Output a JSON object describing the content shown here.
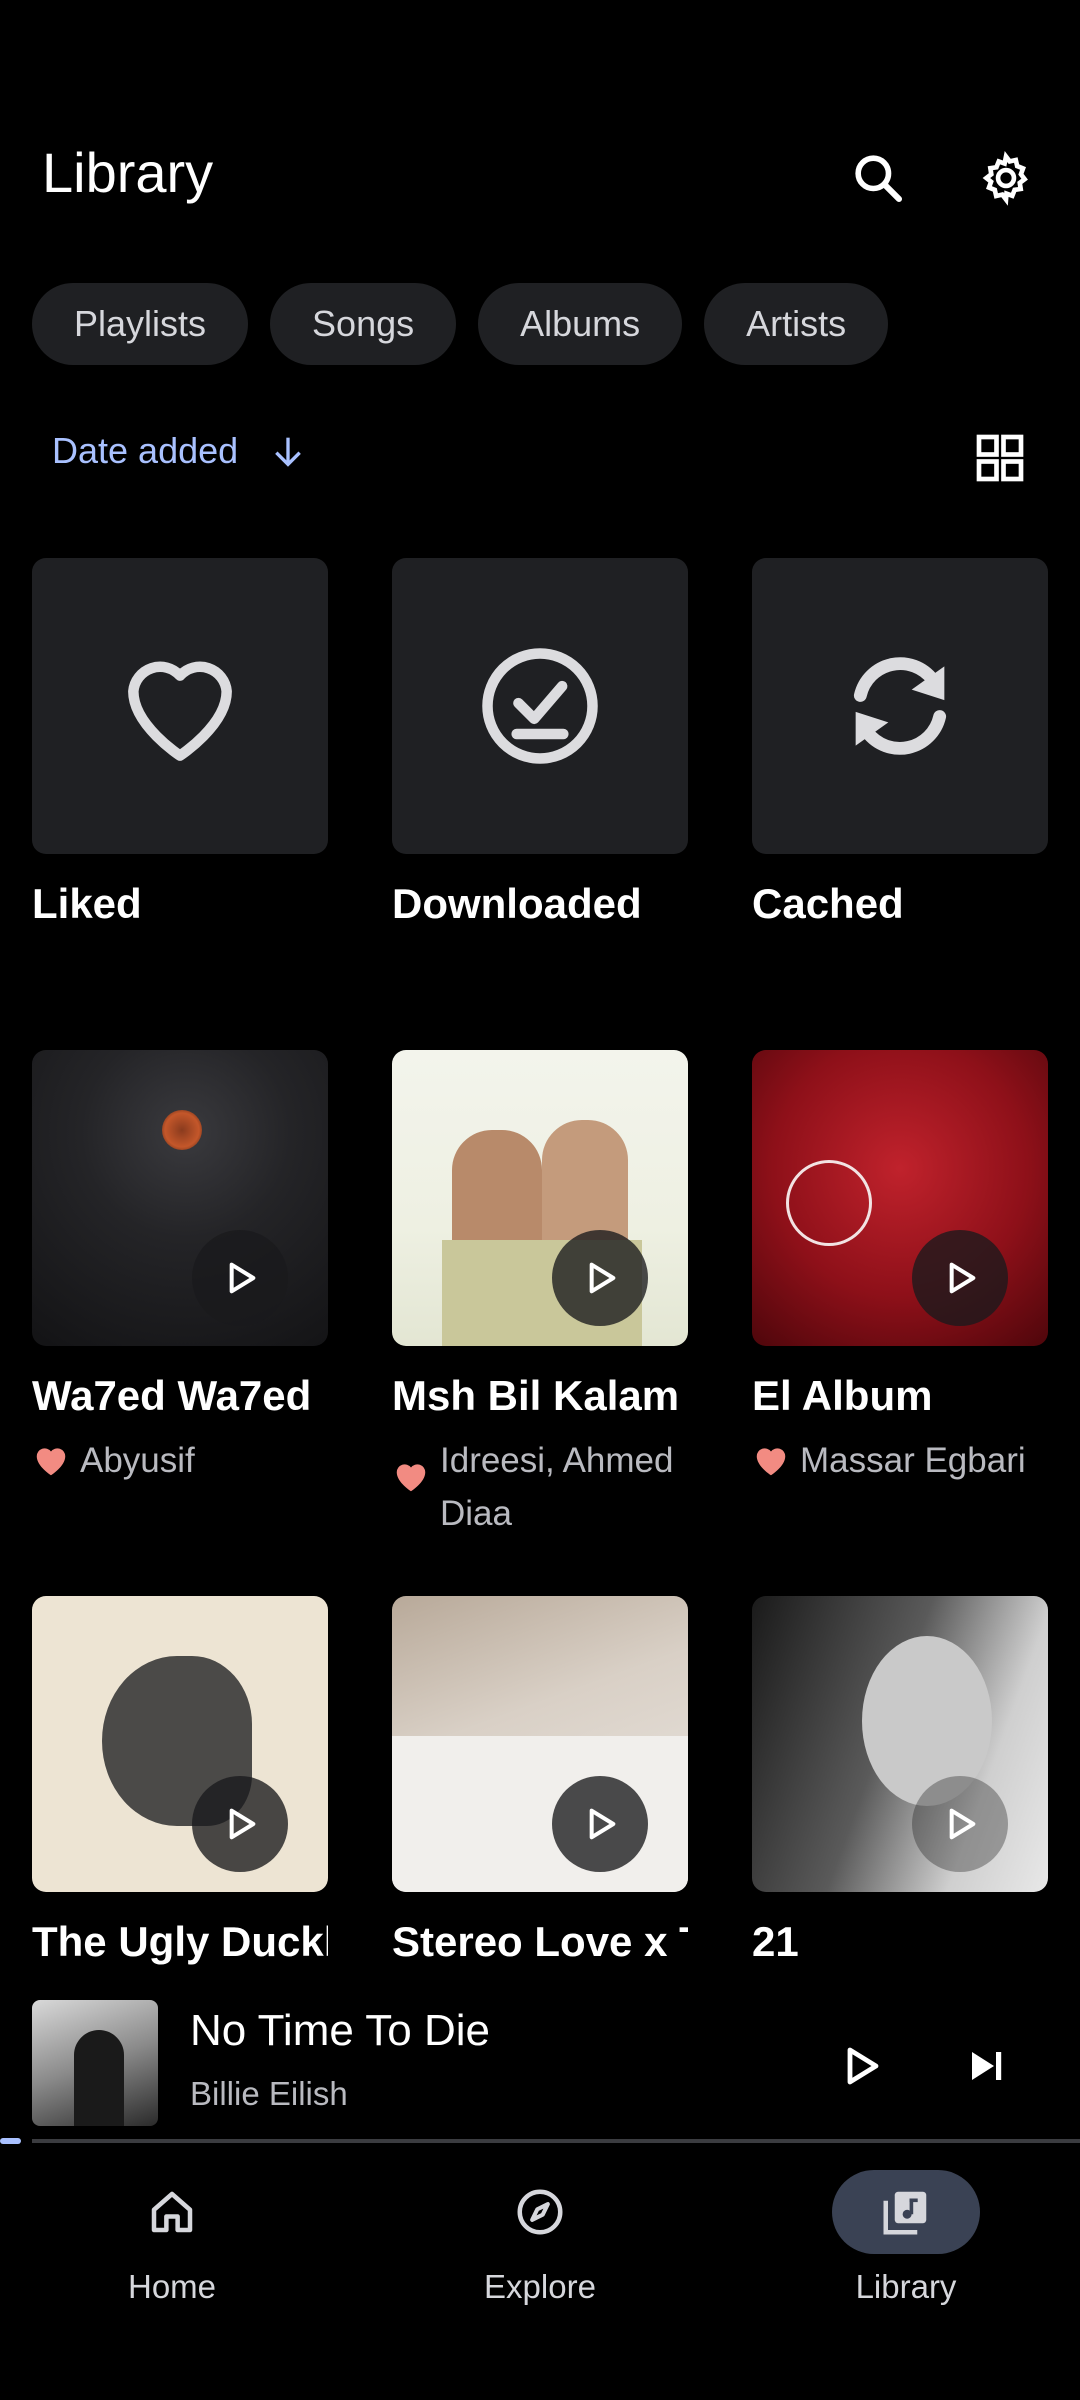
{
  "header": {
    "title": "Library"
  },
  "chips": [
    "Playlists",
    "Songs",
    "Albums",
    "Artists"
  ],
  "sort": {
    "label": "Date added"
  },
  "special": [
    {
      "label": "Liked",
      "icon": "heart-outline-icon"
    },
    {
      "label": "Downloaded",
      "icon": "download-check-icon"
    },
    {
      "label": "Cached",
      "icon": "sync-icon"
    }
  ],
  "albums": [
    {
      "title": "Wa7ed Wa7ed",
      "artist": "Abyusif"
    },
    {
      "title": "Msh Bil Kalam",
      "artist": "Idreesi, Ahmed Diaa"
    },
    {
      "title": "El Album",
      "artist": "Massar Egbari"
    },
    {
      "title": "The Ugly Duckl",
      "artist": ""
    },
    {
      "title": "Stereo Love x T",
      "artist": ""
    },
    {
      "title": "21",
      "artist": ""
    }
  ],
  "now_playing": {
    "title": "No Time To Die",
    "artist": "Billie Eilish",
    "progress_fraction": 0.02
  },
  "nav": [
    {
      "label": "Home",
      "icon": "home-icon"
    },
    {
      "label": "Explore",
      "icon": "compass-icon"
    },
    {
      "label": "Library",
      "icon": "library-music-icon",
      "active": true
    }
  ],
  "colors": {
    "accent": "#a9c1ff",
    "liked": "#f28b82",
    "chip_bg": "#1f2023",
    "nav_active": "#3a4254"
  }
}
